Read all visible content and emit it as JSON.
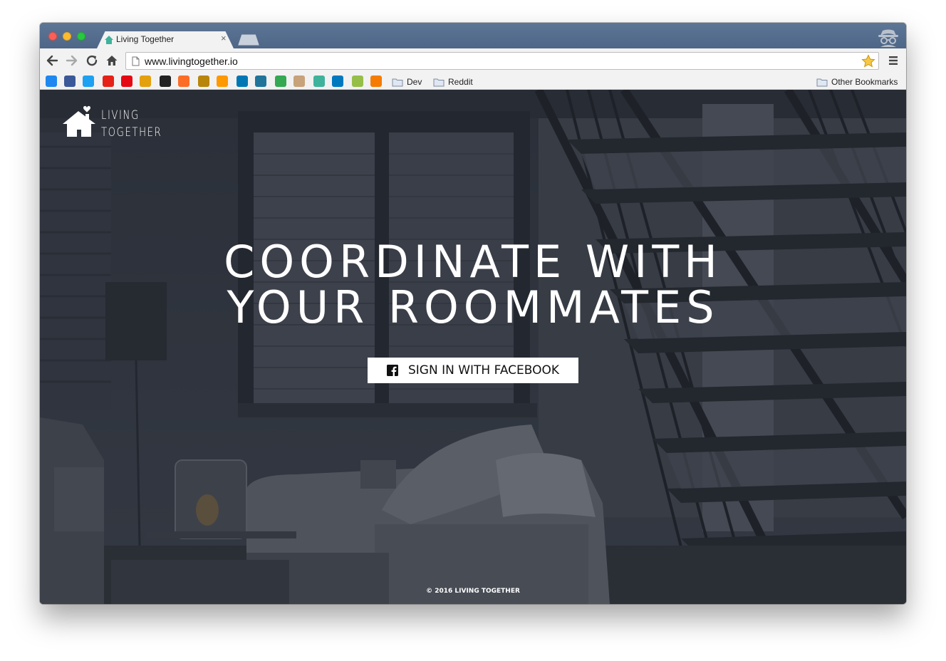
{
  "browser": {
    "tab_title": "Living Together",
    "tab_close": "×",
    "url": "www.livingtogether.io",
    "bookmarks": [
      {
        "icon": "messenger-icon",
        "color": "#1e88f0"
      },
      {
        "icon": "facebook-icon",
        "color": "#3b5998"
      },
      {
        "icon": "twitter-icon",
        "color": "#1da1f2"
      },
      {
        "icon": "youtube-icon",
        "color": "#e62117"
      },
      {
        "icon": "netflix-icon",
        "color": "#e50914"
      },
      {
        "icon": "plex-icon",
        "color": "#e5a00d"
      },
      {
        "icon": "github-icon",
        "color": "#222222"
      },
      {
        "icon": "gitlab-icon",
        "color": "#fc6d26"
      },
      {
        "icon": "crest-icon",
        "color": "#b8860b"
      },
      {
        "icon": "amazon-icon",
        "color": "#ff9900"
      },
      {
        "icon": "linkedin-icon",
        "color": "#0077b5"
      },
      {
        "icon": "wordpress-icon",
        "color": "#21759b"
      },
      {
        "icon": "google-drive-icon",
        "color": "#34a853"
      },
      {
        "icon": "avatar-icon",
        "color": "#c8a27a"
      },
      {
        "icon": "house-icon",
        "color": "#3fb29c"
      },
      {
        "icon": "trello-icon",
        "color": "#0079bf"
      },
      {
        "icon": "shopify-icon",
        "color": "#96bf48"
      },
      {
        "icon": "analytics-icon",
        "color": "#f57c00"
      }
    ],
    "folders": {
      "dev": "Dev",
      "reddit": "Reddit",
      "other": "Other Bookmarks"
    }
  },
  "page": {
    "logo_line1": "LIVING",
    "logo_line2": "TOGETHER",
    "headline_line1": "COORDINATE WITH",
    "headline_line2": "YOUR ROOMMATES",
    "signin_label": "SIGN IN WITH FACEBOOK",
    "footer": "© 2016 LIVING TOGETHER"
  }
}
